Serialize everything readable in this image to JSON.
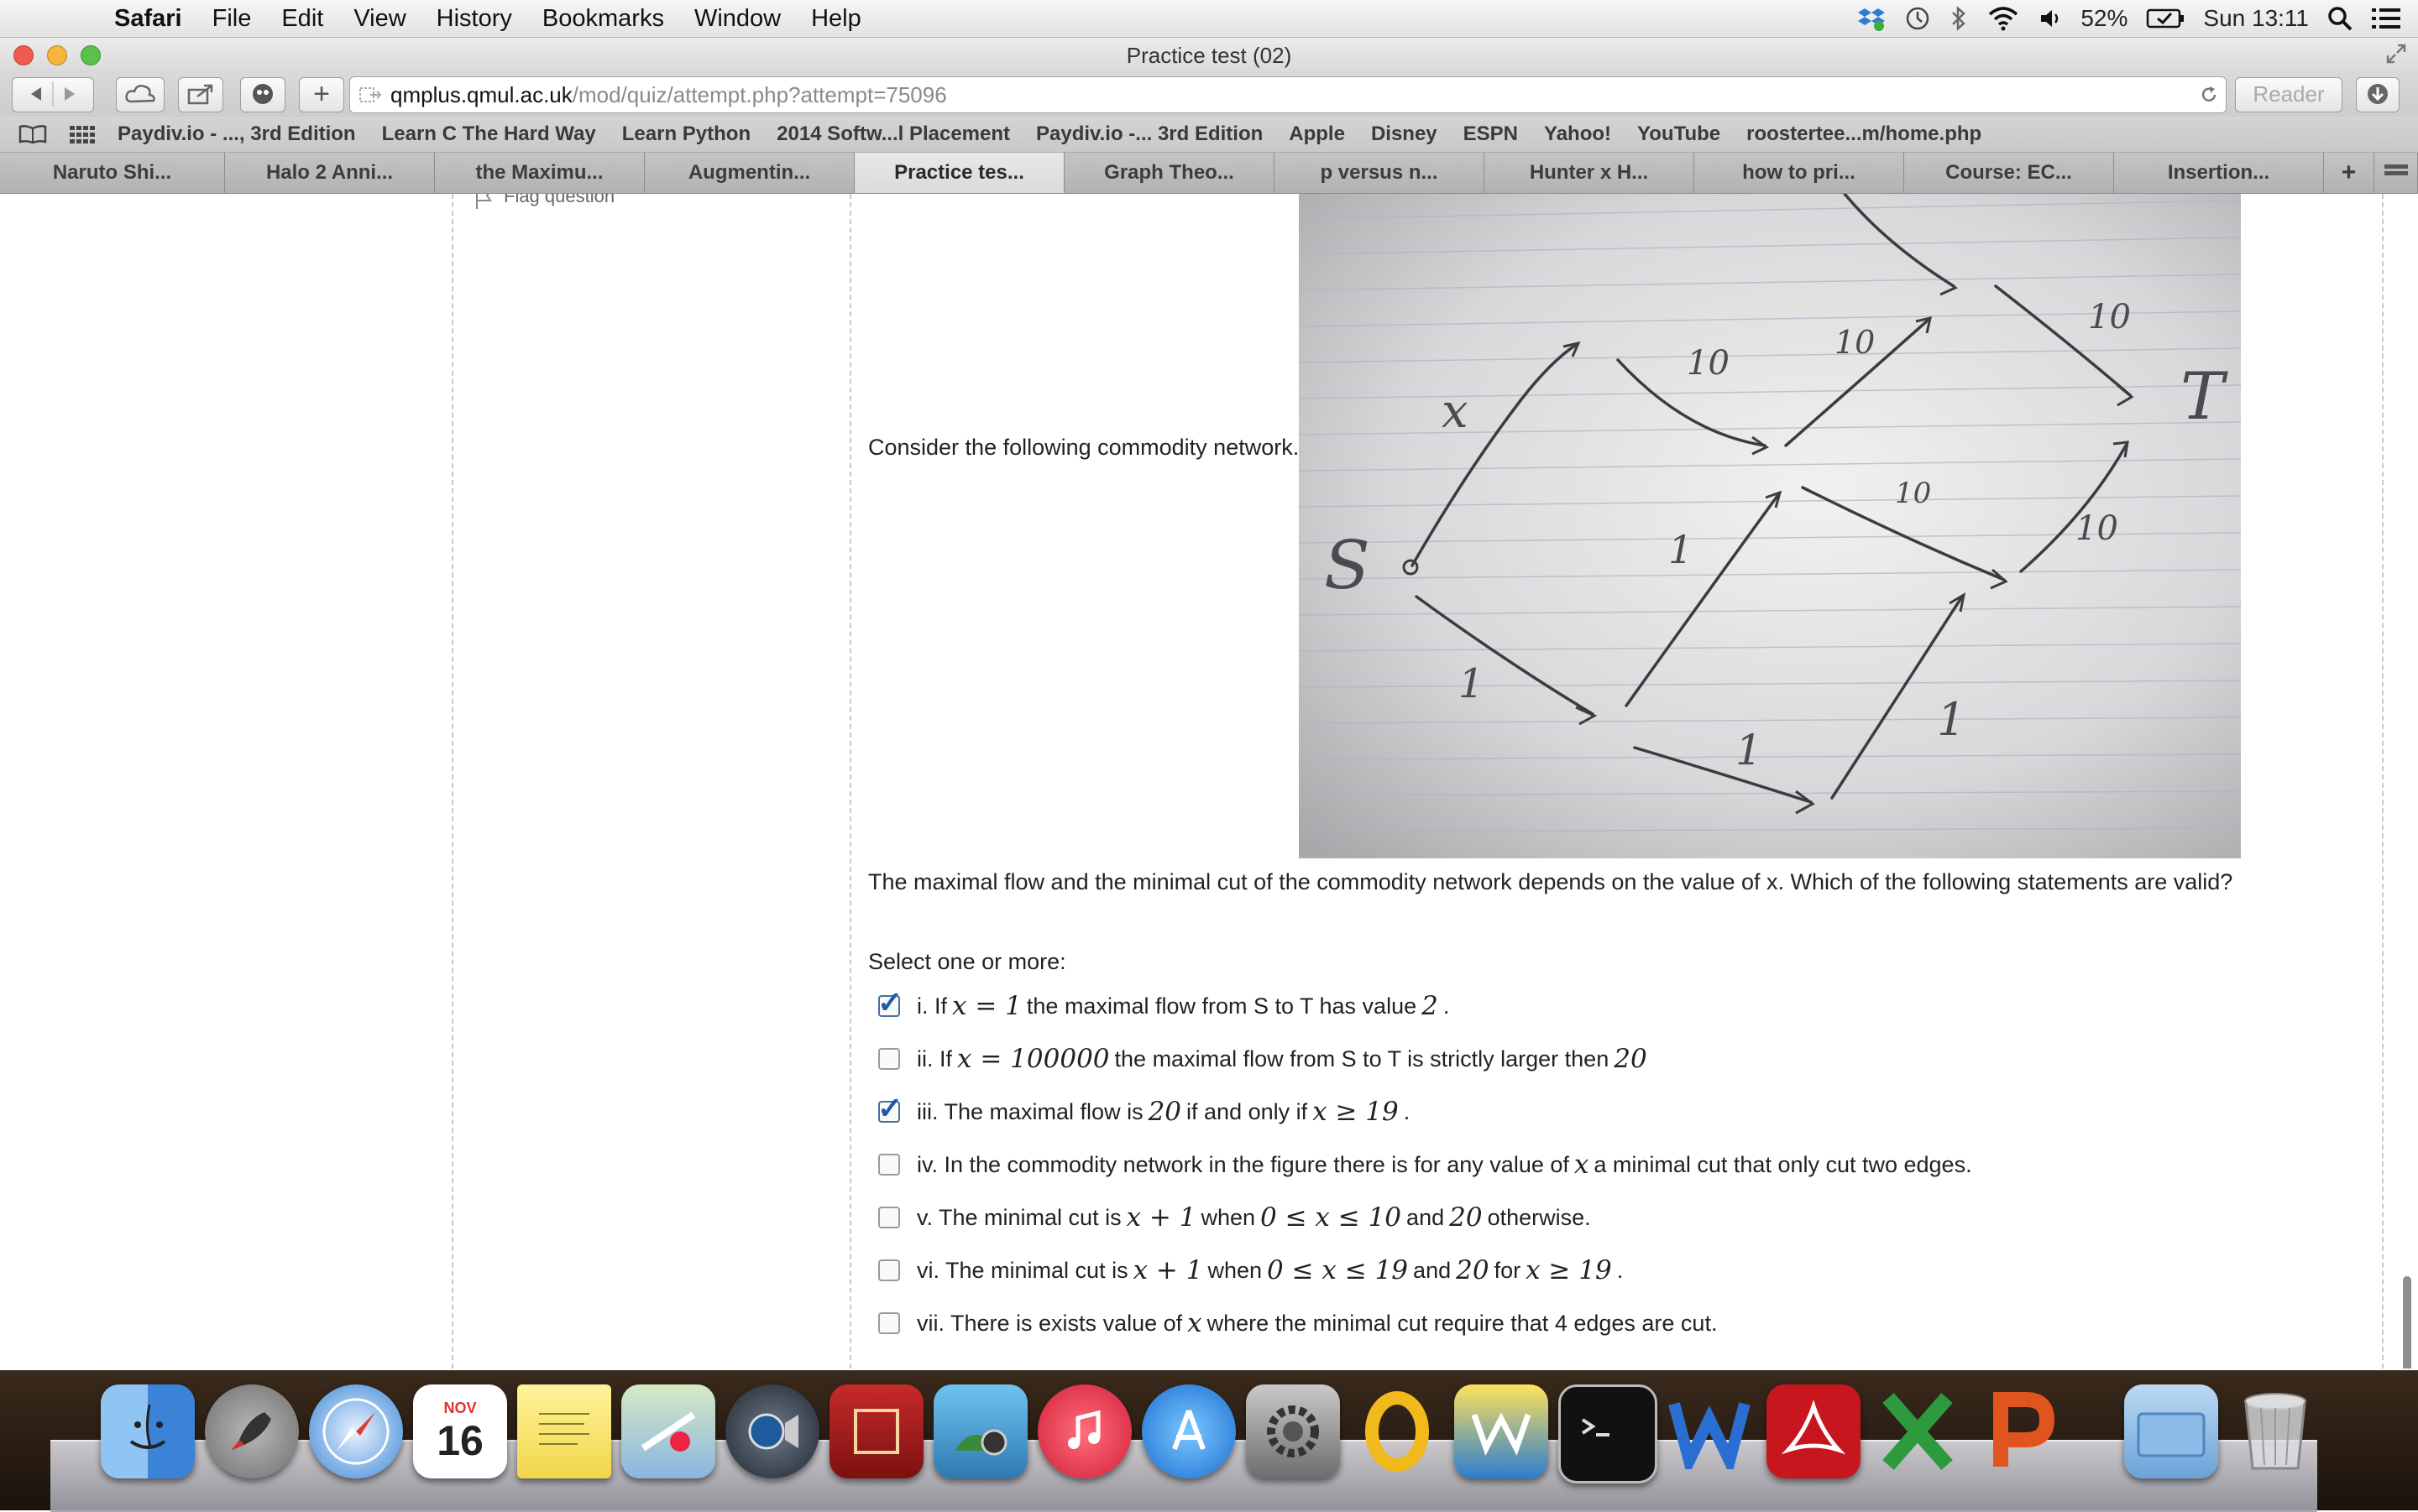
{
  "menubar": {
    "app": "Safari",
    "items": [
      "File",
      "Edit",
      "View",
      "History",
      "Bookmarks",
      "Window",
      "Help"
    ],
    "battery": "52%",
    "clock": "Sun 13:11"
  },
  "window": {
    "title": "Practice test (02)"
  },
  "toolbar": {
    "url_host": "qmplus.qmul.ac.uk",
    "url_path": "/mod/quiz/attempt.php?attempt=75096",
    "reader_label": "Reader"
  },
  "bookmarks": [
    "Paydiv.io - ..., 3rd Edition",
    "Learn C The Hard Way",
    "Learn Python",
    "2014 Softw...l Placement",
    "Paydiv.io -... 3rd Edition",
    "Apple",
    "Disney",
    "ESPN",
    "Yahoo!",
    "YouTube",
    "roostertee...m/home.php"
  ],
  "tabs": [
    "Naruto Shi...",
    "Halo 2 Anni...",
    "the Maximu...",
    "Augmentin...",
    "Practice tes...",
    "Graph Theo...",
    "p versus n...",
    "Hunter x H...",
    "how to pri...",
    "Course: EC...",
    "Insertion..."
  ],
  "quiz": {
    "flag_label": "Flag question",
    "intro": "Consider the following commodity network.",
    "question": "The maximal flow and the minimal cut of the commodity network depends on the value of x.  Which of the following statements are valid?",
    "select_prompt": "Select one or more:",
    "options": [
      {
        "checked": true,
        "parts": [
          "i. If ",
          "x = 1",
          " the maximal flow from S to T has value ",
          "2",
          "."
        ]
      },
      {
        "checked": false,
        "parts": [
          "ii. If ",
          "x = 100000",
          " the maximal flow from S to T is strictly larger then ",
          "20",
          ""
        ]
      },
      {
        "checked": true,
        "parts": [
          "iii. The maximal flow is ",
          "20",
          " if and only if ",
          "x ≥ 19",
          "."
        ]
      },
      {
        "checked": false,
        "parts": [
          "iv. In the commodity network in the figure there is for any value of ",
          "x",
          " a minimal cut that only cut two edges.",
          "",
          ""
        ]
      },
      {
        "checked": false,
        "parts": [
          "v. The minimal cut is ",
          "x + 1",
          " when ",
          "0 ≤ x ≤ 10",
          " and ",
          "20",
          " otherwise."
        ]
      },
      {
        "checked": false,
        "parts": [
          "vi. The minimal cut is ",
          "x + 1",
          " when ",
          "0 ≤ x ≤ 19",
          " and ",
          "20",
          " for ",
          "x ≥ 19",
          "."
        ]
      },
      {
        "checked": false,
        "parts": [
          "vii. There is exists value of ",
          "x",
          " where the minimal cut require that 4 edges are cut.",
          "",
          ""
        ]
      }
    ],
    "figure": {
      "node_labels": [
        "S",
        "T"
      ],
      "edge_labels": [
        "x",
        "10",
        "10",
        "10",
        "10",
        "10",
        "1",
        "1",
        "1",
        "1"
      ]
    }
  },
  "dock": {
    "calendar_month": "NOV",
    "calendar_day": "16"
  }
}
